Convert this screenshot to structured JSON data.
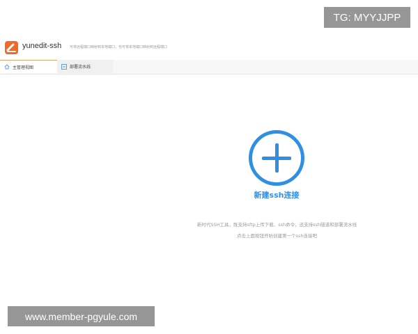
{
  "app": {
    "name": "yunedit-ssh",
    "subtitle": "可将远程端口映射到本地端口，也可将本地端口映射到远程端口",
    "logo_icon": "yunedit-logo-icon",
    "brand_color": "#f06a2a"
  },
  "tabs": [
    {
      "label": "主管理视图",
      "icon": "home-icon",
      "active": true
    },
    {
      "label": "部署流水线",
      "icon": "pipeline-icon",
      "active": false
    }
  ],
  "main": {
    "new_button_icon": "plus-circle-icon",
    "new_button_label": "新建ssh连接",
    "description_line1": "新时代SSH工具，既支持sftp上传下载、ssh命令，还支持ssh隧道和部署流水线",
    "description_line2": "点击上面按钮开始创建第一个ssh连接吧",
    "accent_color": "#2f8fe3"
  },
  "watermarks": {
    "tg": "TG: MYYJJPP",
    "site": "www.member-pgyule.com"
  }
}
